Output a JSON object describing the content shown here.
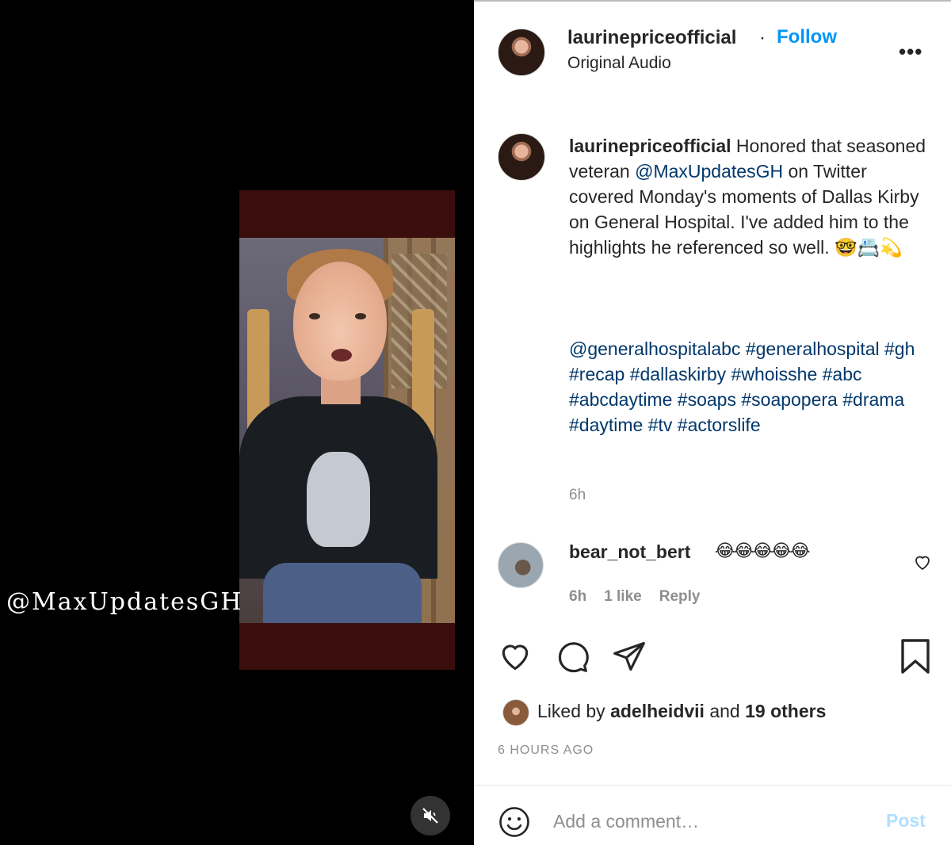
{
  "media": {
    "watermark": "@MaxUpdatesGH",
    "mute_icon": "speaker-muted-icon"
  },
  "header": {
    "username": "laurinepriceofficial",
    "separator": "·",
    "follow_label": "Follow",
    "audio_label": "Original Audio",
    "more_icon": "more-options-icon",
    "more_label": "•••"
  },
  "caption": {
    "username": "laurinepriceofficial",
    "text_part1": " Honored that seasoned veteran ",
    "mention": "@MaxUpdatesGH",
    "text_part2": " on Twitter covered Monday's moments of Dallas Kirby on General Hospital. I've added him to the highlights he referenced so well. ",
    "emoji": "🤓📇💫",
    "hashtags": "@generalhospitalabc #generalhospital #gh #recap #dallaskirby #whoisshe #abc #abcdaytime #soaps #soapopera #drama #daytime #tv #actorslife",
    "time": "6h"
  },
  "comment": {
    "username": "bear_not_bert",
    "emoji": "😂😂😂😂😂",
    "time": "6h",
    "likes": "1 like",
    "reply_label": "Reply"
  },
  "actions": {
    "like_icon": "heart-icon",
    "comment_icon": "comment-icon",
    "share_icon": "share-icon",
    "save_icon": "bookmark-icon"
  },
  "likes": {
    "prefix": "Liked by ",
    "user": "adelheidvii",
    "middle": " and ",
    "others": "19 others"
  },
  "timestamp": "6 HOURS AGO",
  "composer": {
    "placeholder": "Add a comment…",
    "post_label": "Post"
  },
  "colors": {
    "link": "#00376b",
    "follow": "#0095f6",
    "muted": "#8e8e8e",
    "post_disabled": "#b2dffc"
  }
}
